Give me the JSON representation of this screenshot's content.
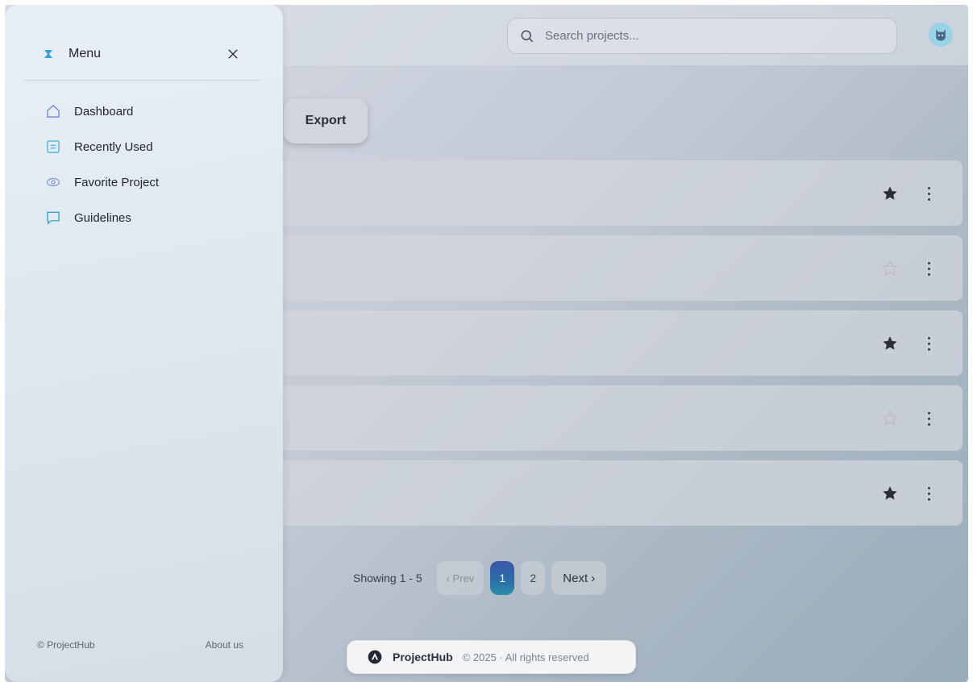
{
  "search": {
    "placeholder": "Search projects..."
  },
  "toolbar": {
    "export_label": "Export"
  },
  "rows": [
    {
      "starred": true
    },
    {
      "starred": false
    },
    {
      "starred": true
    },
    {
      "starred": false
    },
    {
      "starred": true
    }
  ],
  "pagination": {
    "info": "Showing 1 - 5",
    "prev_label": "‹ Prev",
    "pages": [
      "1",
      "2"
    ],
    "current": "1",
    "next_label": "Next ›"
  },
  "footer": {
    "brand": "ProjectHub",
    "copyright": "© 2025 · All rights reserved"
  },
  "drawer": {
    "title": "Menu",
    "items": [
      {
        "label": "Dashboard",
        "icon": "home-icon"
      },
      {
        "label": "Recently Used",
        "icon": "list-icon"
      },
      {
        "label": "Favorite Project",
        "icon": "eye-icon"
      },
      {
        "label": "Guidelines",
        "icon": "chat-icon"
      }
    ],
    "footer_left": "© ProjectHub",
    "footer_right": "About us"
  },
  "colors": {
    "accent_icon": "#6f86d6",
    "page_active_start": "#3d55a8",
    "page_active_end": "#2a8fa8",
    "star_filled": "#2b2f38",
    "star_empty": "#b8bcc4"
  }
}
